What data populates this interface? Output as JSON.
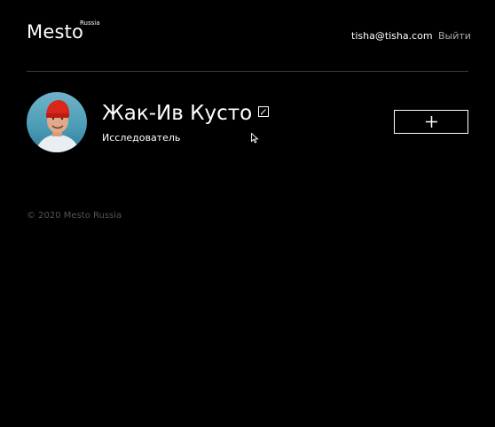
{
  "header": {
    "logo_text": "Mesto",
    "logo_sub": "Russia",
    "email": "tisha@tisha.com",
    "logout_label": "Выйти"
  },
  "profile": {
    "name": "Жак-Ив Кусто",
    "job": "Исследователь",
    "avatar_icon": "avatar-photo",
    "edit_icon": "pencil-icon",
    "add_icon": "plus-icon"
  },
  "footer": {
    "copyright": "© 2020 Mesto Russia"
  },
  "colors": {
    "background": "#000000",
    "text": "#ffffff",
    "muted": "#545454",
    "logout": "#a9a9a9"
  }
}
